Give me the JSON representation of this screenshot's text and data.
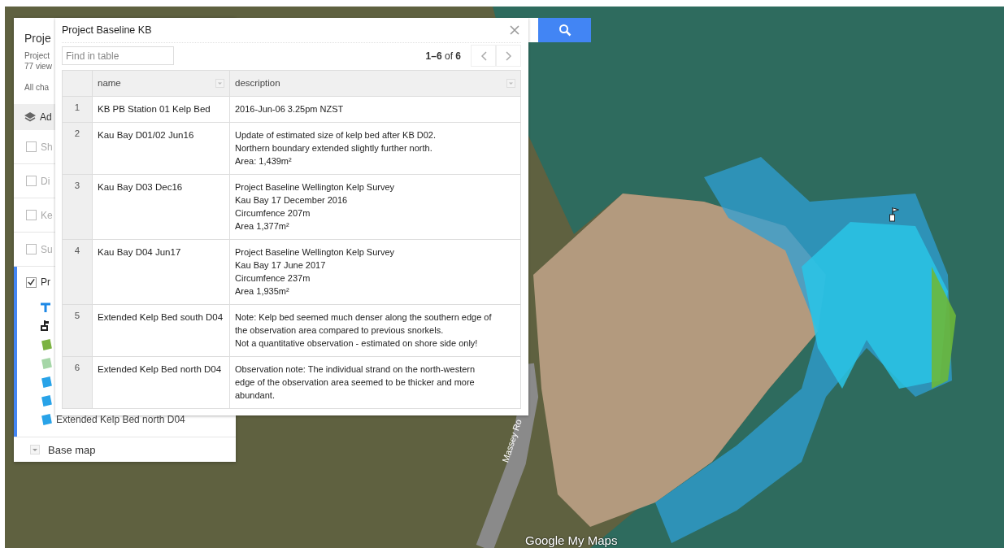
{
  "map": {
    "road_label": "Massey Ro",
    "logo": "Google My Maps"
  },
  "sidebar": {
    "title": "Proje",
    "subtitle": "Project",
    "views": "77 view",
    "changes": "All cha",
    "add_layer": "Ad",
    "layers": [
      {
        "label": "Sh",
        "checked": false
      },
      {
        "label": "Di",
        "checked": false
      },
      {
        "label": "Ke",
        "checked": false
      },
      {
        "label": "Su",
        "checked": false
      },
      {
        "label": "Pr",
        "checked": true
      }
    ],
    "features": [
      {
        "kind": "line",
        "color": "#1e88e5"
      },
      {
        "kind": "marker",
        "color": "#222222"
      },
      {
        "kind": "polygon",
        "color": "#7cb342"
      },
      {
        "kind": "polygon",
        "color": "#a5d6a7"
      },
      {
        "kind": "polygon",
        "color": "#29a3e8"
      },
      {
        "kind": "polygon",
        "color": "#29a3e8"
      },
      {
        "kind": "polygon",
        "color": "#29a3e8",
        "label": "Extended Kelp Bed north D04"
      }
    ],
    "base_map": "Base map"
  },
  "dialog": {
    "title": "Project Baseline KB",
    "search_placeholder": "Find in table",
    "pagination": "**1–6** of **6**",
    "columns": [
      "name",
      "description"
    ],
    "rows": [
      {
        "num": "1",
        "name": "KB PB Station 01 Kelp Bed",
        "description": "2016-Jun-06 3.25pm NZST"
      },
      {
        "num": "2",
        "name": "Kau Bay D01/02 Jun16",
        "description": "Update of estimated size of kelp bed after KB D02.\nNorthern boundary extended slightly further north.\nArea: 1,439m²"
      },
      {
        "num": "3",
        "name": "Kau Bay D03 Dec16",
        "description": "Project Baseline Wellington Kelp Survey\nKau Bay 17 December 2016\nCircumfence 207m\nArea 1,377m²"
      },
      {
        "num": "4",
        "name": "Kau Bay D04 Jun17",
        "description": "Project Baseline Wellington Kelp Survey\nKau Bay 17 June 2017\nCircumfence 237m\nArea 1,935m²"
      },
      {
        "num": "5",
        "name": "Extended Kelp Bed south D04",
        "description": "Note: Kelp bed seemed much denser along the southern edge of\nthe observation area compared to previous snorkels.\nNot a quantitative observation - estimated on shore side only!"
      },
      {
        "num": "6",
        "name": "Extended Kelp Bed north D04",
        "description": "Observation note: The individual strand on the north-western\nedge of the observation area seemed to be thicker and more\nabundant."
      }
    ]
  }
}
